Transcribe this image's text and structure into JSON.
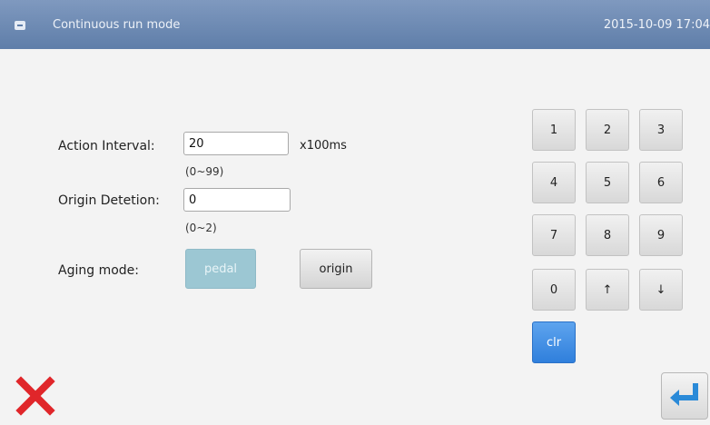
{
  "header": {
    "title": "Continuous run mode",
    "datetime": "2015-10-09 17:04"
  },
  "form": {
    "action_interval": {
      "label": "Action Interval:",
      "value": "20",
      "unit": "x100ms",
      "range": "(0~99)"
    },
    "origin_detection": {
      "label": "Origin Detetion:",
      "value": "0",
      "range": "(0~2)"
    },
    "aging_mode": {
      "label": "Aging mode:",
      "options": [
        "pedal",
        "origin"
      ],
      "selected": "pedal"
    }
  },
  "keypad": {
    "keys": [
      "1",
      "2",
      "3",
      "4",
      "5",
      "6",
      "7",
      "8",
      "9",
      "0",
      "↑",
      "↓"
    ],
    "clear_label": "clr"
  },
  "footer": {
    "cancel_icon": "close-x-icon",
    "confirm_icon": "enter-arrow-icon"
  },
  "colors": {
    "titlebar": "#6b88b2",
    "active_mode": "#9cc7d3",
    "clear_key": "#3b87e0",
    "cancel_red": "#e0262a",
    "enter_blue": "#2a8ad8"
  }
}
